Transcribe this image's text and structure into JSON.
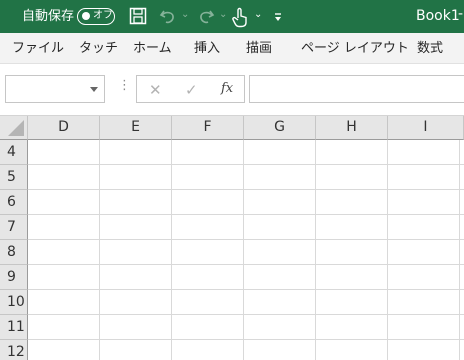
{
  "titlebar": {
    "autosave_label": "自動保存",
    "toggle_state": "オフ",
    "doc_title": "Book1",
    "separator": "-",
    "bg_color": "#217346",
    "icons": [
      "save-icon",
      "undo-icon",
      "redo-icon",
      "touch-mode-icon",
      "customize-toolbar-icon"
    ]
  },
  "ribbon": {
    "tabs": [
      "ファイル",
      "タッチ",
      "ホーム",
      "挿入",
      "描画",
      "ページ レイアウト",
      "数式"
    ]
  },
  "formula_bar": {
    "name_box_value": "",
    "cancel_symbol": "✕",
    "enter_symbol": "✓",
    "fx_label": "fx",
    "formula_value": ""
  },
  "grid": {
    "columns": [
      "D",
      "E",
      "F",
      "G",
      "H",
      "I"
    ],
    "rows": [
      "4",
      "5",
      "6",
      "7",
      "8",
      "9",
      "10",
      "11",
      "12"
    ]
  }
}
